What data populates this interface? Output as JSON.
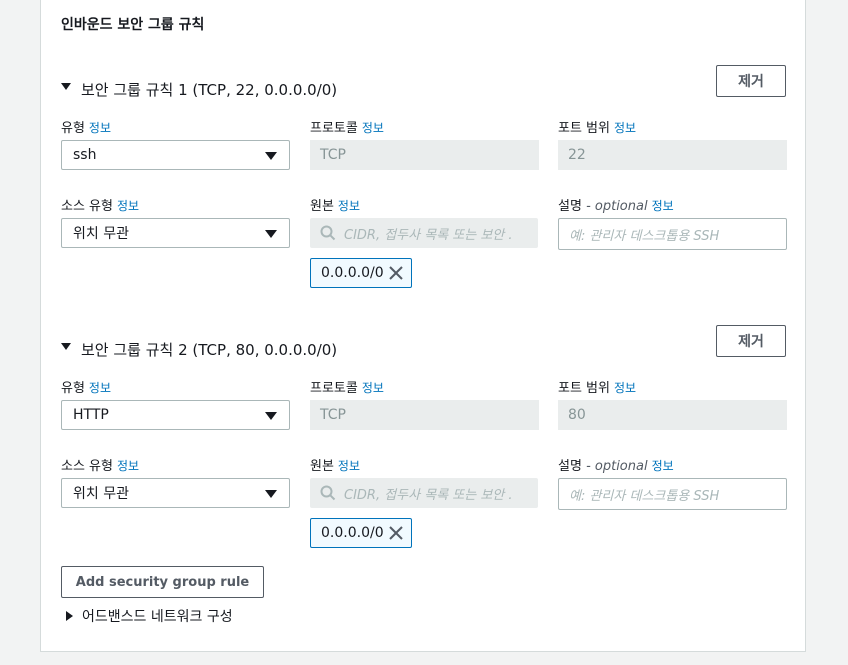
{
  "section": {
    "title": "인바운드 보안 그룹 규칙"
  },
  "rules": [
    {
      "header": "보안 그룹 규칙 1 (TCP, 22, 0.0.0.0/0)",
      "remove_label": "제거",
      "type_label": "유형",
      "type_value": "ssh",
      "protocol_label": "프로토콜",
      "protocol_value": "TCP",
      "port_label": "포트 범위",
      "port_value": "22",
      "source_type_label": "소스 유형",
      "source_type_value": "위치 무관",
      "source_label": "원본",
      "source_placeholder": "CIDR, 접두사 목록 또는 보안 .",
      "description_label": "설명",
      "description_optional": "- optional",
      "description_placeholder": "예: 관리자 데스크톱용 SSH",
      "token": "0.0.0.0/0"
    },
    {
      "header": "보안 그룹 규칙 2 (TCP, 80, 0.0.0.0/0)",
      "remove_label": "제거",
      "type_label": "유형",
      "type_value": "HTTP",
      "protocol_label": "프로토콜",
      "protocol_value": "TCP",
      "port_label": "포트 범위",
      "port_value": "80",
      "source_type_label": "소스 유형",
      "source_type_value": "위치 무관",
      "source_label": "원본",
      "source_placeholder": "CIDR, 접두사 목록 또는 보안 .",
      "description_label": "설명",
      "description_optional": "- optional",
      "description_placeholder": "예: 관리자 데스크톱용 SSH",
      "token": "0.0.0.0/0"
    }
  ],
  "info_link": "정보",
  "add_rule_label": "Add security group rule",
  "advanced_label": "어드밴스드 네트워크 구성",
  "icons": {
    "remove_token": "close-icon",
    "search": "search-icon",
    "expand": "caret-down-icon",
    "collapse": "caret-right-icon"
  },
  "colors": {
    "link": "#0073bb",
    "token_border": "#0073bb",
    "disabled_bg": "#eaeded"
  }
}
